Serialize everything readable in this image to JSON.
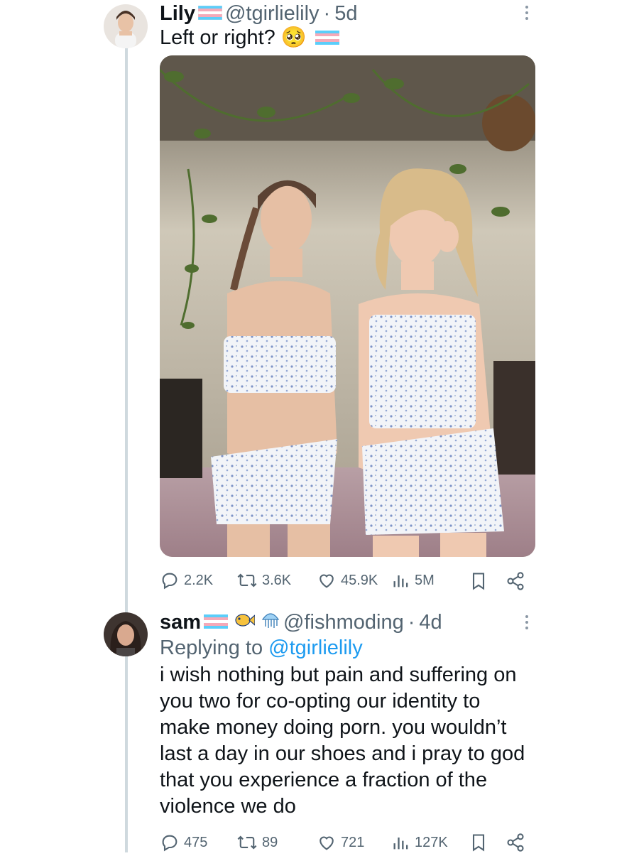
{
  "post": {
    "author_name": "Lily",
    "handle": "@tgirlielily",
    "separator": "·",
    "age": "5d",
    "text": "Left or right?",
    "emoji": "🥺",
    "media_alt": "Two women posing in matching blue floral crop tops and shorts under hanging plants",
    "stats": {
      "replies": "2.2K",
      "reposts": "3.6K",
      "likes": "45.9K",
      "views": "5M"
    }
  },
  "reply": {
    "author_name": "sam",
    "handle": "@fishmoding",
    "separator": "·",
    "age": "4d",
    "replying_prefix": "Replying to",
    "replying_to": "@tgirlielily",
    "text_lines": [
      "i wish nothing but pain and suffering on",
      "you two for co-opting our identity to",
      "make money doing porn. you wouldn’t",
      "last a day in our shoes and i pray to god",
      "that you experience a fraction of the",
      "violence we do"
    ],
    "stats": {
      "replies": "475",
      "reposts": "89",
      "likes": "721",
      "views": "127K"
    }
  },
  "colors": {
    "link": "#1d9bf0",
    "muted": "#536471",
    "thread": "#cfd9de",
    "flag_blue": "#5bcefa",
    "flag_pink": "#f5a9b8"
  },
  "icons": [
    "reply-icon",
    "repost-icon",
    "like-icon",
    "views-icon",
    "bookmark-icon",
    "share-icon",
    "more-icon",
    "trans-flag-icon",
    "fish-icon",
    "jellyfish-icon"
  ]
}
